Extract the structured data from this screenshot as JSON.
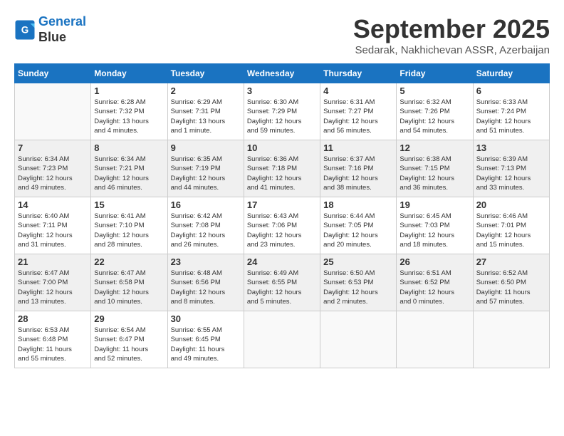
{
  "header": {
    "logo_line1": "General",
    "logo_line2": "Blue",
    "month": "September 2025",
    "location": "Sedarak, Nakhichevan ASSR, Azerbaijan"
  },
  "days_of_week": [
    "Sunday",
    "Monday",
    "Tuesday",
    "Wednesday",
    "Thursday",
    "Friday",
    "Saturday"
  ],
  "weeks": [
    [
      {
        "day": "",
        "info": ""
      },
      {
        "day": "1",
        "info": "Sunrise: 6:28 AM\nSunset: 7:32 PM\nDaylight: 13 hours\nand 4 minutes."
      },
      {
        "day": "2",
        "info": "Sunrise: 6:29 AM\nSunset: 7:31 PM\nDaylight: 13 hours\nand 1 minute."
      },
      {
        "day": "3",
        "info": "Sunrise: 6:30 AM\nSunset: 7:29 PM\nDaylight: 12 hours\nand 59 minutes."
      },
      {
        "day": "4",
        "info": "Sunrise: 6:31 AM\nSunset: 7:27 PM\nDaylight: 12 hours\nand 56 minutes."
      },
      {
        "day": "5",
        "info": "Sunrise: 6:32 AM\nSunset: 7:26 PM\nDaylight: 12 hours\nand 54 minutes."
      },
      {
        "day": "6",
        "info": "Sunrise: 6:33 AM\nSunset: 7:24 PM\nDaylight: 12 hours\nand 51 minutes."
      }
    ],
    [
      {
        "day": "7",
        "info": "Sunrise: 6:34 AM\nSunset: 7:23 PM\nDaylight: 12 hours\nand 49 minutes."
      },
      {
        "day": "8",
        "info": "Sunrise: 6:34 AM\nSunset: 7:21 PM\nDaylight: 12 hours\nand 46 minutes."
      },
      {
        "day": "9",
        "info": "Sunrise: 6:35 AM\nSunset: 7:19 PM\nDaylight: 12 hours\nand 44 minutes."
      },
      {
        "day": "10",
        "info": "Sunrise: 6:36 AM\nSunset: 7:18 PM\nDaylight: 12 hours\nand 41 minutes."
      },
      {
        "day": "11",
        "info": "Sunrise: 6:37 AM\nSunset: 7:16 PM\nDaylight: 12 hours\nand 38 minutes."
      },
      {
        "day": "12",
        "info": "Sunrise: 6:38 AM\nSunset: 7:15 PM\nDaylight: 12 hours\nand 36 minutes."
      },
      {
        "day": "13",
        "info": "Sunrise: 6:39 AM\nSunset: 7:13 PM\nDaylight: 12 hours\nand 33 minutes."
      }
    ],
    [
      {
        "day": "14",
        "info": "Sunrise: 6:40 AM\nSunset: 7:11 PM\nDaylight: 12 hours\nand 31 minutes."
      },
      {
        "day": "15",
        "info": "Sunrise: 6:41 AM\nSunset: 7:10 PM\nDaylight: 12 hours\nand 28 minutes."
      },
      {
        "day": "16",
        "info": "Sunrise: 6:42 AM\nSunset: 7:08 PM\nDaylight: 12 hours\nand 26 minutes."
      },
      {
        "day": "17",
        "info": "Sunrise: 6:43 AM\nSunset: 7:06 PM\nDaylight: 12 hours\nand 23 minutes."
      },
      {
        "day": "18",
        "info": "Sunrise: 6:44 AM\nSunset: 7:05 PM\nDaylight: 12 hours\nand 20 minutes."
      },
      {
        "day": "19",
        "info": "Sunrise: 6:45 AM\nSunset: 7:03 PM\nDaylight: 12 hours\nand 18 minutes."
      },
      {
        "day": "20",
        "info": "Sunrise: 6:46 AM\nSunset: 7:01 PM\nDaylight: 12 hours\nand 15 minutes."
      }
    ],
    [
      {
        "day": "21",
        "info": "Sunrise: 6:47 AM\nSunset: 7:00 PM\nDaylight: 12 hours\nand 13 minutes."
      },
      {
        "day": "22",
        "info": "Sunrise: 6:47 AM\nSunset: 6:58 PM\nDaylight: 12 hours\nand 10 minutes."
      },
      {
        "day": "23",
        "info": "Sunrise: 6:48 AM\nSunset: 6:56 PM\nDaylight: 12 hours\nand 8 minutes."
      },
      {
        "day": "24",
        "info": "Sunrise: 6:49 AM\nSunset: 6:55 PM\nDaylight: 12 hours\nand 5 minutes."
      },
      {
        "day": "25",
        "info": "Sunrise: 6:50 AM\nSunset: 6:53 PM\nDaylight: 12 hours\nand 2 minutes."
      },
      {
        "day": "26",
        "info": "Sunrise: 6:51 AM\nSunset: 6:52 PM\nDaylight: 12 hours\nand 0 minutes."
      },
      {
        "day": "27",
        "info": "Sunrise: 6:52 AM\nSunset: 6:50 PM\nDaylight: 11 hours\nand 57 minutes."
      }
    ],
    [
      {
        "day": "28",
        "info": "Sunrise: 6:53 AM\nSunset: 6:48 PM\nDaylight: 11 hours\nand 55 minutes."
      },
      {
        "day": "29",
        "info": "Sunrise: 6:54 AM\nSunset: 6:47 PM\nDaylight: 11 hours\nand 52 minutes."
      },
      {
        "day": "30",
        "info": "Sunrise: 6:55 AM\nSunset: 6:45 PM\nDaylight: 11 hours\nand 49 minutes."
      },
      {
        "day": "",
        "info": ""
      },
      {
        "day": "",
        "info": ""
      },
      {
        "day": "",
        "info": ""
      },
      {
        "day": "",
        "info": ""
      }
    ]
  ]
}
